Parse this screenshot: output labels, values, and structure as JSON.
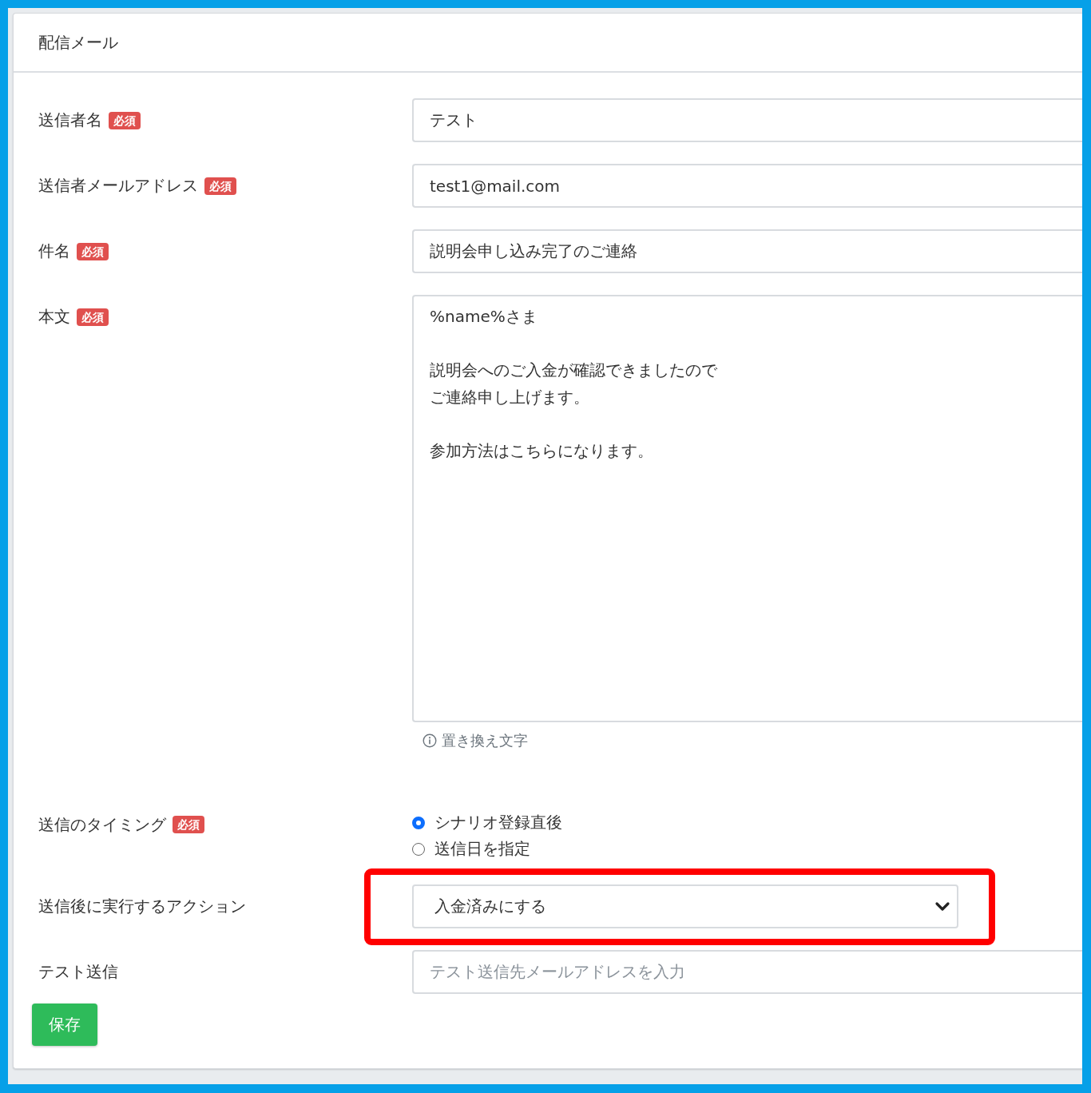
{
  "card": {
    "title": "配信メール"
  },
  "fields": [
    {
      "kind": "text",
      "label": "送信者名",
      "badge": "必須",
      "value": "テスト"
    },
    {
      "kind": "text",
      "label": "送信者メールアドレス",
      "badge": "必須",
      "value": "test1@mail.com"
    },
    {
      "kind": "text",
      "label": "件名",
      "badge": "必須",
      "value": "説明会申し込み完了のご連絡"
    },
    {
      "kind": "textarea",
      "label": "本文",
      "badge": "必須",
      "paragraphs": [
        [
          "%name%さま"
        ],
        [
          "説明会へのご入金が確認できましたので",
          "ご連絡申し上げます。"
        ],
        [
          "参加方法はこちらになります。"
        ]
      ],
      "hint": "置き換え文字"
    },
    {
      "kind": "radio",
      "label": "送信のタイミング",
      "badge": "必須",
      "options": [
        {
          "label": "シナリオ登録直後",
          "selected": true
        },
        {
          "label": "送信日を指定",
          "selected": false
        }
      ]
    },
    {
      "kind": "select",
      "label": "送信後に実行するアクション",
      "value": "入金済みにする",
      "highlighted": true
    },
    {
      "kind": "text",
      "label": "テスト送信",
      "placeholder": "テスト送信先メールアドレスを入力"
    }
  ],
  "save_button": "保存"
}
